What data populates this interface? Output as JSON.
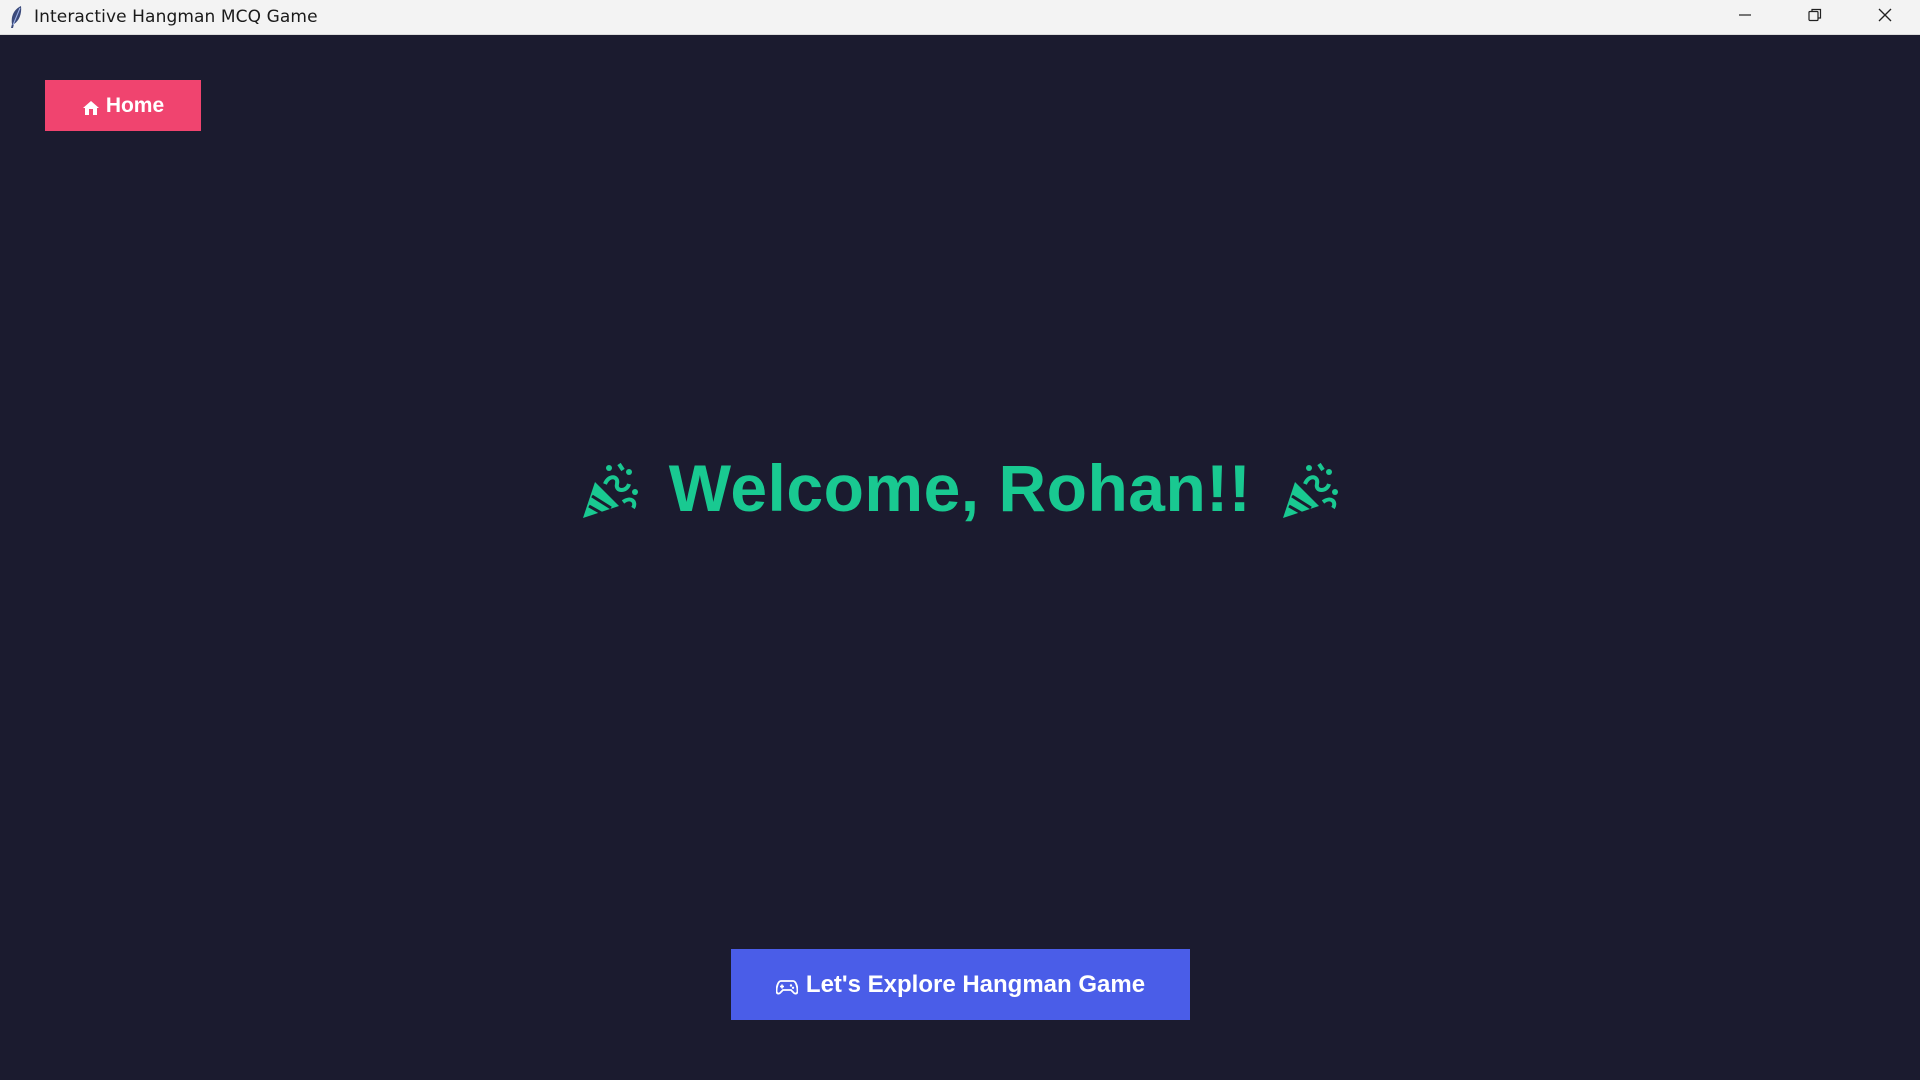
{
  "window": {
    "title": "Interactive Hangman MCQ Game"
  },
  "nav": {
    "home_label": "Home",
    "home_icon": "house-icon"
  },
  "welcome": {
    "text": "Welcome, Rohan!!",
    "decoration_icon": "party-popper-icon",
    "color": "#19c991"
  },
  "cta": {
    "label": "Let's Explore Hangman Game",
    "icon": "game-controller-icon"
  },
  "colors": {
    "background": "#1b1b2f",
    "home_button": "#f0446f",
    "cta_button": "#4a5de8",
    "accent_text": "#19c991"
  }
}
